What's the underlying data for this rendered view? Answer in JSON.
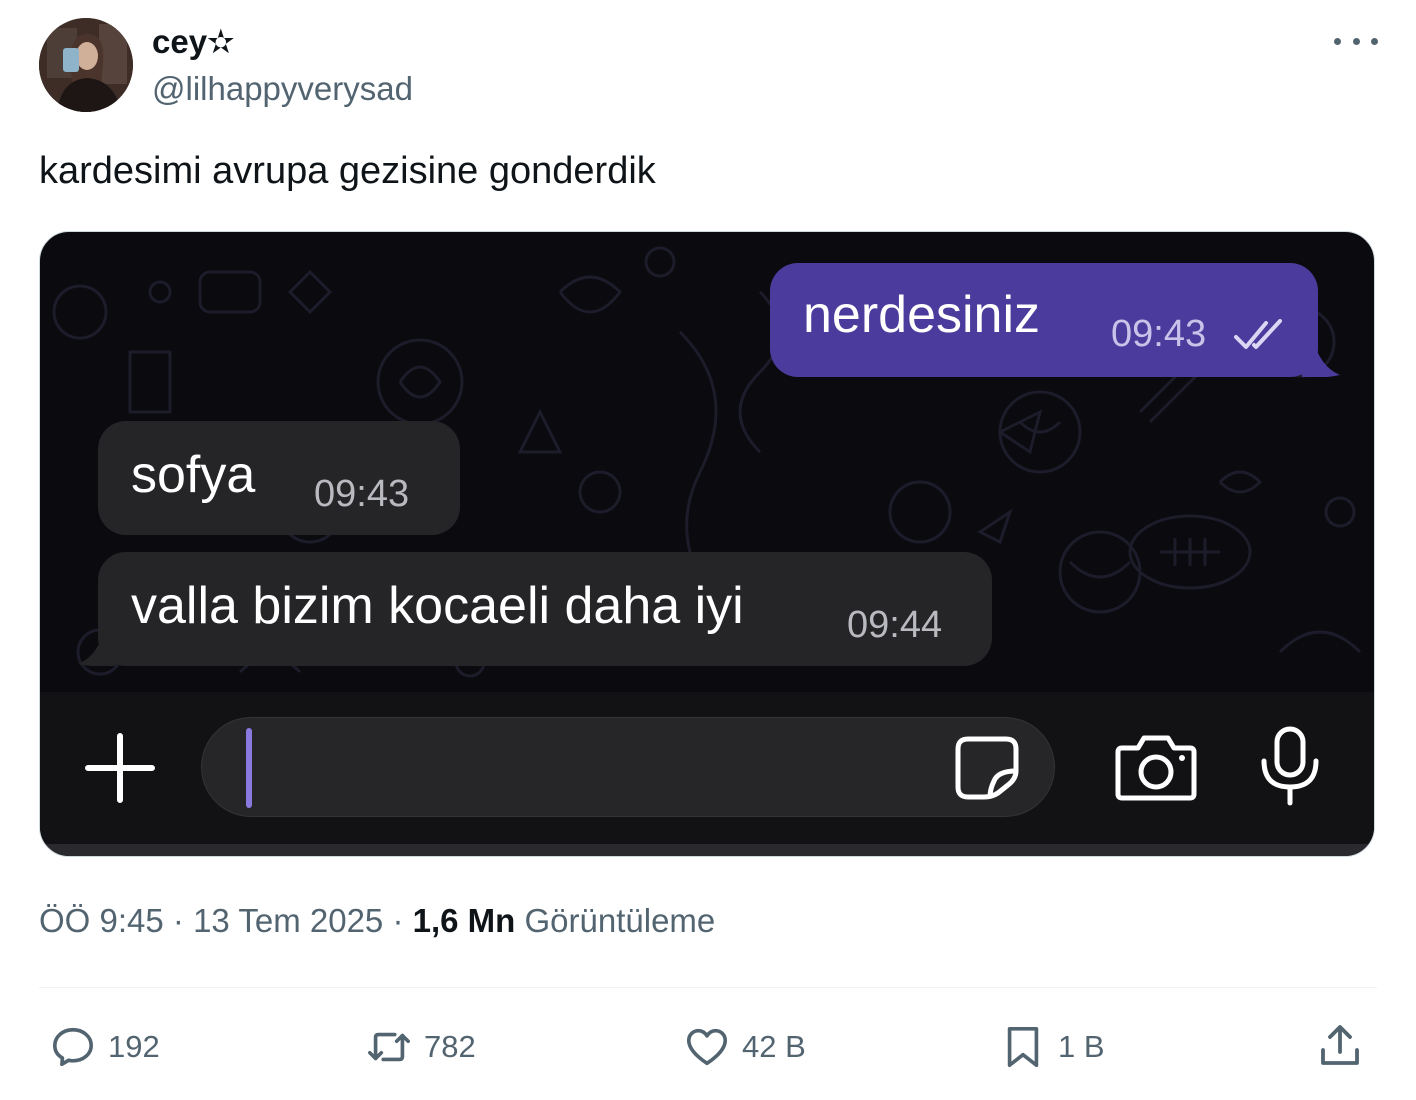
{
  "author": {
    "display_name": "cey✫",
    "handle": "@lilhappyverysad"
  },
  "tweet": {
    "text": "kardesimi avrupa gezisine gonderdik"
  },
  "chat": {
    "messages": [
      {
        "direction": "outgoing",
        "text": "nerdesiniz",
        "time": "09:43",
        "status": "read"
      },
      {
        "direction": "incoming",
        "text": "sofya",
        "time": "09:43"
      },
      {
        "direction": "incoming",
        "text": "valla bizim kocaeli daha iyi",
        "time": "09:44"
      }
    ],
    "colors": {
      "outgoing_bubble": "#4b3b9c",
      "incoming_bubble": "#252528",
      "background": "#0a0a0f",
      "caret": "#8a7ae0"
    },
    "icons": [
      "plus-icon",
      "sticker-icon",
      "camera-icon",
      "microphone-icon",
      "double-check-icon"
    ]
  },
  "meta": {
    "time": "ÖÖ 9:45",
    "separator": "·",
    "date": "13 Tem 2025",
    "views_count": "1,6 Mn",
    "views_label": "Görüntüleme"
  },
  "actions": {
    "replies": "192",
    "reposts": "782",
    "likes": "42 B",
    "bookmarks": "1 B"
  },
  "colors": {
    "text_primary": "#0f1419",
    "text_secondary": "#536471",
    "divider": "#eff3f4"
  }
}
